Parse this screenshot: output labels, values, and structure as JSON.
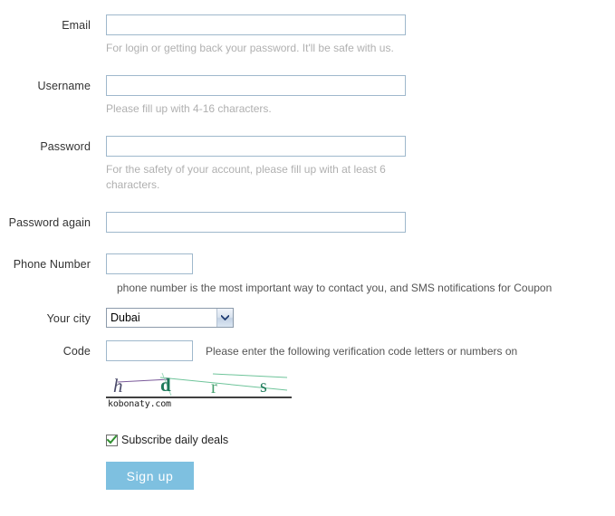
{
  "form": {
    "fields": {
      "email": {
        "label": "Email",
        "value": "",
        "hint": "For login or getting back your password. It'll be safe with us."
      },
      "username": {
        "label": "Username",
        "value": "",
        "hint": "Please fill up with 4-16 characters."
      },
      "password": {
        "label": "Password",
        "value": "",
        "hint": "For the safety of your account, please fill up with at least 6 characters."
      },
      "password_again": {
        "label": "Password again",
        "value": ""
      },
      "phone": {
        "label": "Phone Number",
        "value": "",
        "hint": "phone number is the most important way to contact you, and SMS notifications for Coupon"
      },
      "city": {
        "label": "Your city",
        "selected": "Dubai",
        "options": [
          "Dubai"
        ]
      },
      "code": {
        "label": "Code",
        "value": "",
        "hint": "Please enter the following verification code letters or numbers on"
      }
    },
    "captcha": {
      "characters": [
        {
          "glyph": "h",
          "color": "#4a4a6a"
        },
        {
          "glyph": "d",
          "color": "#1e7a5a"
        },
        {
          "glyph": "r",
          "color": "#46a06e"
        },
        {
          "glyph": "s",
          "color": "#1e7a5a"
        }
      ],
      "watermark": "kobonaty.com",
      "line_colors": [
        "#7a5a9a",
        "#6ec49a",
        "#6ec49a"
      ]
    },
    "subscribe": {
      "label": "Subscribe daily deals",
      "checked": true
    },
    "submit": {
      "label": "Sign up"
    }
  },
  "colors": {
    "input_border": "#9fb8cc",
    "hint_text": "#b0b0b0",
    "label_text": "#333333",
    "button_bg": "#7ec0e0",
    "button_text": "#ffffff",
    "check_mark": "#2f8f2f"
  }
}
